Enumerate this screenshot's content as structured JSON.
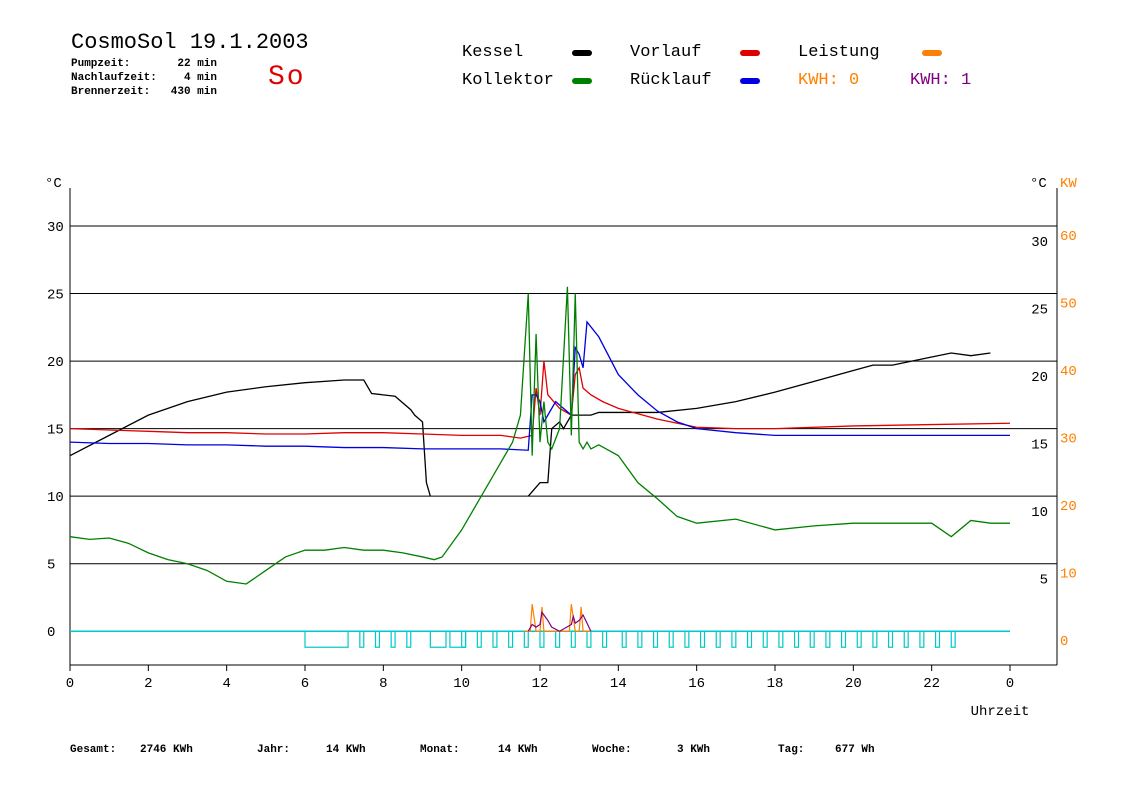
{
  "header": {
    "title": "CosmoSol 19.1.2003",
    "day": "So",
    "stats": [
      {
        "label": "Pumpzeit:",
        "value": "22 min"
      },
      {
        "label": "Nachlaufzeit:",
        "value": "4 min"
      },
      {
        "label": "Brennerzeit:",
        "value": "430 min"
      }
    ]
  },
  "legend": {
    "kessel": "Kessel",
    "kollektor": "Kollektor",
    "vorlauf": "Vorlauf",
    "ruecklauf": "Rücklauf",
    "leistung": "Leistung",
    "kwh0": "KWH: 0",
    "kwh1": "KWH: 1"
  },
  "footer": [
    {
      "label": "Gesamt:",
      "value": "2746 KWh"
    },
    {
      "label": "Jahr:",
      "value": "14 KWh"
    },
    {
      "label": "Monat:",
      "value": "14 KWh"
    },
    {
      "label": "Woche:",
      "value": "3 KWh"
    },
    {
      "label": "Tag:",
      "value": "677 Wh"
    }
  ],
  "chart_data": {
    "type": "line",
    "xlabel": "Uhrzeit",
    "y_left_label": "°C",
    "y_right_label": "°C",
    "y_right2_label": "KW",
    "xlim": [
      0,
      24
    ],
    "ylim": [
      -2.5,
      34
    ],
    "x_ticks": [
      "0",
      "2",
      "4",
      "6",
      "8",
      "10",
      "12",
      "14",
      "16",
      "18",
      "20",
      "22",
      "0"
    ],
    "y_ticks_left": [
      "0",
      "5",
      "10",
      "15",
      "20",
      "25",
      "30"
    ],
    "y_ticks_right": [
      "5",
      "10",
      "15",
      "20",
      "25",
      "30"
    ],
    "y_ticks_kw": [
      "0",
      "10",
      "20",
      "30",
      "40",
      "50",
      "60"
    ],
    "colors": {
      "kessel": "#000000",
      "kollektor": "#008000",
      "vorlauf": "#e00000",
      "ruecklauf": "#0000e0",
      "leistung": "#ff8000",
      "kwh0": "#ff8000",
      "kwh1": "#800080",
      "pump": "#00c8c8"
    },
    "series": [
      {
        "name": "Kessel",
        "x": [
          0,
          1,
          2,
          3,
          4,
          5,
          6,
          7,
          7.5,
          7.7,
          8.3,
          8.7,
          8.8,
          9,
          9.1,
          9.2
        ],
        "y": [
          13,
          14.5,
          16,
          17,
          17.7,
          18.1,
          18.4,
          18.6,
          18.6,
          17.6,
          17.4,
          16.4,
          16,
          15.5,
          11,
          10
        ],
        "x2": [
          11.7,
          12,
          12.2,
          12.3,
          12.5,
          12.6,
          12.8,
          13,
          13.3,
          13.5,
          14,
          15,
          16,
          17,
          18,
          19,
          20,
          20.5,
          21,
          22,
          22.5,
          23,
          23.5
        ],
        "y2": [
          10,
          11,
          11,
          15,
          15.5,
          15,
          16,
          16,
          16,
          16.2,
          16.2,
          16.2,
          16.5,
          17,
          17.7,
          18.5,
          19.3,
          19.7,
          19.7,
          20.3,
          20.6,
          20.4,
          20.6
        ]
      },
      {
        "name": "Vorlauf",
        "x": [
          0,
          1,
          2,
          3,
          4,
          5,
          6,
          7,
          8,
          9,
          10,
          11,
          11.5,
          11.8,
          11.9,
          12,
          12.1,
          12.2,
          12.5,
          12.8,
          12.9,
          13,
          13.1,
          13.3,
          13.6,
          14,
          15,
          16,
          17,
          18,
          20,
          22,
          24
        ],
        "y": [
          15,
          14.9,
          14.8,
          14.7,
          14.7,
          14.6,
          14.6,
          14.7,
          14.7,
          14.6,
          14.5,
          14.5,
          14.3,
          14.5,
          18,
          16,
          20,
          17.5,
          16.5,
          16,
          19,
          19.5,
          18,
          17.5,
          17,
          16.5,
          15.7,
          15.1,
          15,
          15,
          15.2,
          15.3,
          15.4
        ]
      },
      {
        "name": "Rücklauf",
        "x": [
          0,
          1,
          2,
          3,
          4,
          5,
          6,
          7,
          8,
          9,
          10,
          11,
          11.7,
          11.8,
          11.9,
          12,
          12.1,
          12.2,
          12.4,
          12.6,
          12.8,
          12.9,
          13,
          13.1,
          13.2,
          13.5,
          14,
          14.5,
          15,
          15.5,
          16,
          17,
          18,
          20,
          22,
          24
        ],
        "y": [
          14,
          13.9,
          13.9,
          13.8,
          13.8,
          13.7,
          13.7,
          13.6,
          13.6,
          13.5,
          13.5,
          13.5,
          13.4,
          17.5,
          17.5,
          17,
          15.5,
          16,
          17,
          16.5,
          16,
          21,
          20.5,
          19.5,
          22.9,
          21.8,
          19,
          17.5,
          16.3,
          15.5,
          15,
          14.7,
          14.5,
          14.5,
          14.5,
          14.5
        ]
      },
      {
        "name": "Kollektor",
        "x": [
          0,
          0.5,
          1,
          1.5,
          2,
          2.5,
          3,
          3.5,
          4,
          4.5,
          5,
          5.5,
          6,
          6.5,
          7,
          7.5,
          8,
          8.5,
          9,
          9.3,
          9.5,
          10,
          10.5,
          11,
          11.3,
          11.5,
          11.7,
          11.8,
          11.9,
          12,
          12.1,
          12.2,
          12.3,
          12.5,
          12.7,
          12.8,
          12.9,
          13,
          13.1,
          13.2,
          13.3,
          13.5,
          14,
          14.5,
          15,
          15.5,
          16,
          17,
          18,
          19,
          20,
          21,
          22,
          22.5,
          23,
          23.5,
          24
        ],
        "y": [
          7,
          6.8,
          6.9,
          6.5,
          5.8,
          5.3,
          5,
          4.5,
          3.7,
          3.5,
          4.5,
          5.5,
          6,
          6,
          6.2,
          6,
          6,
          5.8,
          5.5,
          5.3,
          5.5,
          7.5,
          10,
          12.5,
          14,
          16,
          25,
          13,
          22,
          14,
          17,
          14,
          13.5,
          15,
          25.5,
          14.5,
          25,
          14,
          13.5,
          14,
          13.5,
          13.8,
          13,
          11,
          9.8,
          8.5,
          8,
          8.3,
          7.5,
          7.8,
          8,
          8,
          8,
          7,
          8.2,
          8,
          8
        ]
      },
      {
        "name": "Leistung",
        "x": [
          11.6,
          11.75,
          11.8,
          11.9,
          12,
          12.05,
          12.1,
          12.2,
          12.5,
          12.7,
          12.75,
          12.8,
          12.9,
          12.95,
          13,
          13.05,
          13.1,
          13.2,
          13.3
        ],
        "y": [
          0,
          0,
          2,
          0,
          0,
          1.8,
          0,
          0,
          0,
          0,
          0,
          2,
          0,
          0,
          0,
          1.8,
          0,
          0,
          0
        ]
      },
      {
        "name": "KWH: 1",
        "x": [
          11.7,
          11.8,
          11.9,
          12,
          12.05,
          12.1,
          12.2,
          12.3,
          12.5,
          12.8,
          12.85,
          12.9,
          13,
          13.1,
          13.2,
          13.3
        ],
        "y": [
          0,
          0.5,
          0.3,
          0.5,
          1.4,
          1.2,
          0.8,
          0.3,
          0,
          0.5,
          1.1,
          0.6,
          0.8,
          1.2,
          0.6,
          0
        ]
      }
    ],
    "pump": {
      "name": "Pump",
      "baseline": 0,
      "pulses_x": [
        [
          6,
          7.1
        ],
        [
          7.4,
          7.5
        ],
        [
          7.8,
          7.9
        ],
        [
          8.2,
          8.3
        ],
        [
          8.6,
          8.7
        ],
        [
          9.2,
          9.6
        ],
        [
          9.7,
          10.1
        ],
        [
          10,
          10.1
        ],
        [
          10.4,
          10.5
        ],
        [
          10.8,
          10.9
        ],
        [
          11.2,
          11.3
        ],
        [
          11.6,
          11.7
        ],
        [
          12,
          12.1
        ],
        [
          12.4,
          12.5
        ],
        [
          12.8,
          12.9
        ],
        [
          13.2,
          13.3
        ],
        [
          13.6,
          13.7
        ],
        [
          14.1,
          14.2
        ],
        [
          14.5,
          14.6
        ],
        [
          14.9,
          15.0
        ],
        [
          15.3,
          15.4
        ],
        [
          15.7,
          15.8
        ],
        [
          16.1,
          16.2
        ],
        [
          16.5,
          16.6
        ],
        [
          16.9,
          17.0
        ],
        [
          17.3,
          17.4
        ],
        [
          17.7,
          17.8
        ],
        [
          18.1,
          18.2
        ],
        [
          18.5,
          18.6
        ],
        [
          18.9,
          19.0
        ],
        [
          19.3,
          19.4
        ],
        [
          19.7,
          19.8
        ],
        [
          20.1,
          20.2
        ],
        [
          20.5,
          20.6
        ],
        [
          20.9,
          21.0
        ],
        [
          21.3,
          21.4
        ],
        [
          21.7,
          21.8
        ],
        [
          22.1,
          22.2
        ],
        [
          22.5,
          22.6
        ]
      ]
    }
  }
}
